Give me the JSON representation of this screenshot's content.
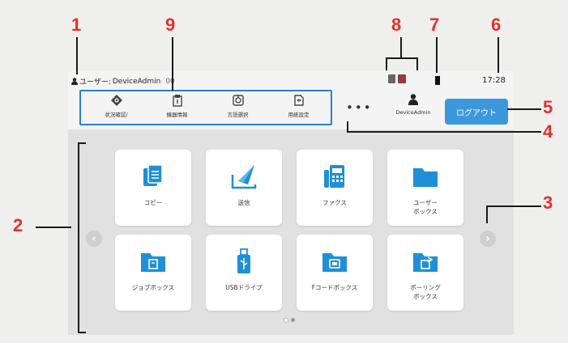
{
  "header": {
    "user_label": "ユーザー:",
    "user_name": "DeviceAdmin",
    "user_extra": "00",
    "time": "17:28"
  },
  "quick_items": [
    {
      "label": "状況確認/",
      "icon": "status-check-icon"
    },
    {
      "label": "機器情報",
      "icon": "device-info-icon"
    },
    {
      "label": "言語選択",
      "icon": "language-icon"
    },
    {
      "label": "用紙設定",
      "icon": "paper-settings-icon"
    }
  ],
  "more_label": "•••",
  "admin_label": "DeviceAdmin",
  "logout_label": "ログアウト",
  "tiles": [
    {
      "label": "コピー",
      "icon": "copy-icon"
    },
    {
      "label": "送信",
      "icon": "send-icon"
    },
    {
      "label": "ファクス",
      "icon": "fax-icon"
    },
    {
      "label": "ユーザー\nボックス",
      "icon": "user-box-folder-icon"
    },
    {
      "label": "ジョブボックス",
      "icon": "job-box-folder-icon"
    },
    {
      "label": "USBドライブ",
      "icon": "usb-drive-icon"
    },
    {
      "label": "Fコードボックス",
      "icon": "fcode-box-folder-icon"
    },
    {
      "label": "ポーリング\nボックス",
      "icon": "polling-box-folder-icon"
    }
  ],
  "nav": {
    "prev": "‹",
    "next": "›"
  },
  "callouts": [
    "1",
    "2",
    "3",
    "4",
    "5",
    "6",
    "7",
    "8",
    "9"
  ],
  "colors": {
    "accent": "#3c98dc",
    "icon_blue": "#1f8fd6",
    "callout_red": "#e0322b"
  }
}
